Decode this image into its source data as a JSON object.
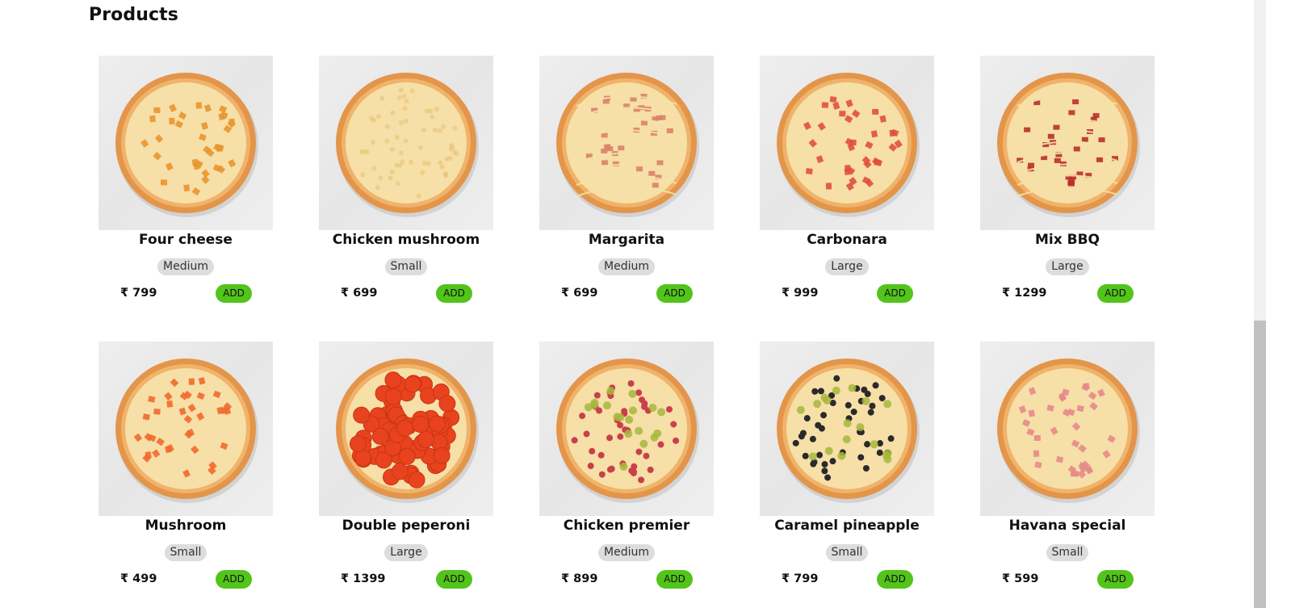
{
  "section": {
    "title": "Products"
  },
  "colors": {
    "accent": "#52c41a",
    "badge_bg": "#dedcdc",
    "text": "#111111"
  },
  "products": [
    {
      "name": "Four cheese",
      "size": "Medium",
      "price": "₹ 799",
      "button": "ADD",
      "image_icon": "pizza-four-cheese-icon",
      "topping": "#e8962e",
      "topping_style": "chunks"
    },
    {
      "name": "Chicken mushroom",
      "size": "Small",
      "price": "₹ 699",
      "button": "ADD",
      "image_icon": "pizza-chicken-mushroom-icon",
      "topping": "#f2d99a",
      "topping_style": "plain"
    },
    {
      "name": "Margarita",
      "size": "Medium",
      "price": "₹ 699",
      "button": "ADD",
      "image_icon": "pizza-margarita-icon",
      "topping": "#d9826a",
      "topping_style": "drizzle"
    },
    {
      "name": "Carbonara",
      "size": "Large",
      "price": "₹ 999",
      "button": "ADD",
      "image_icon": "pizza-carbonara-icon",
      "topping": "#e0503a",
      "topping_style": "chunks"
    },
    {
      "name": "Mix BBQ",
      "size": "Large",
      "price": "₹ 1299",
      "button": "ADD",
      "image_icon": "pizza-mix-bbq-icon",
      "topping": "#b8302a",
      "topping_style": "drizzle"
    },
    {
      "name": "Mushroom",
      "size": "Small",
      "price": "₹ 499",
      "button": "ADD",
      "image_icon": "pizza-mushroom-icon",
      "topping": "#f06a2a",
      "topping_style": "chunks"
    },
    {
      "name": "Double peperoni",
      "size": "Large",
      "price": "₹ 1399",
      "button": "ADD",
      "image_icon": "pizza-double-peperoni-icon",
      "topping": "#e8431e",
      "topping_style": "pepperoni"
    },
    {
      "name": "Chicken premier",
      "size": "Medium",
      "price": "₹ 899",
      "button": "ADD",
      "image_icon": "pizza-chicken-premier-icon",
      "topping": "#c9404a",
      "topping_style": "dots"
    },
    {
      "name": "Caramel pineapple",
      "size": "Small",
      "price": "₹ 799",
      "button": "ADD",
      "image_icon": "pizza-caramel-pineapple-icon",
      "topping": "#2a2a2a",
      "topping_style": "dots"
    },
    {
      "name": "Havana special",
      "size": "Small",
      "price": "₹ 599",
      "button": "ADD",
      "image_icon": "pizza-havana-special-icon",
      "topping": "#e58a8a",
      "topping_style": "chunks"
    }
  ]
}
